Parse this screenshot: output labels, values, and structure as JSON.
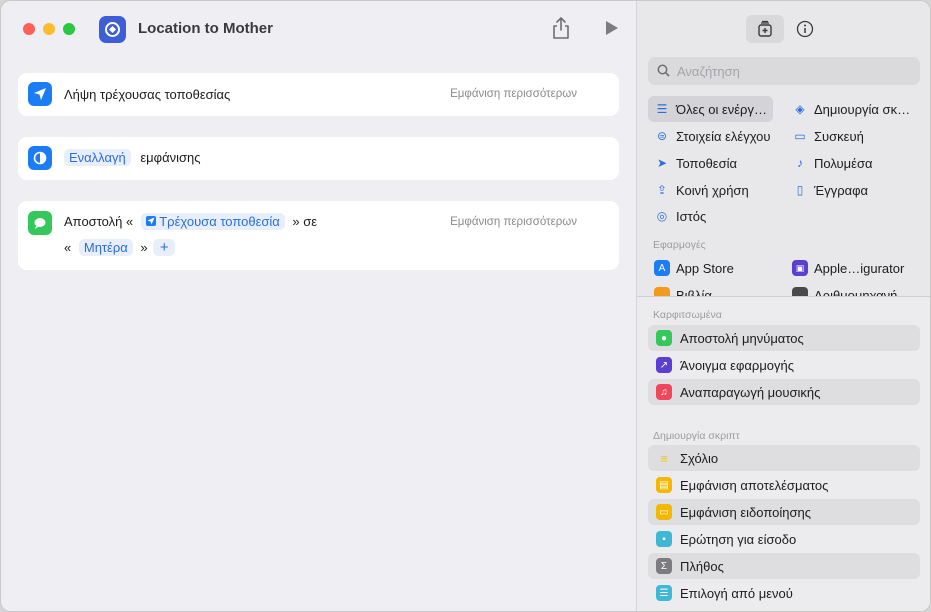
{
  "window": {
    "title": "Location to Mother"
  },
  "actions": [
    {
      "text": "Λήψη τρέχουσας τοποθεσίας",
      "more": "Εμφάνιση περισσότερων"
    },
    {
      "token": "Εναλλαγή",
      "text": "εμφάνισης"
    },
    {
      "prefix": "Αποστολή «",
      "token": "Τρέχουσα τοποθεσία",
      "mid": "» σε",
      "open": "«",
      "token2": "Μητέρα",
      "close": "»",
      "more": "Εμφάνιση περισσότερων"
    }
  ],
  "library": {
    "search_placeholder": "Αναζήτηση",
    "categories": [
      "Όλες οι ενέργ…",
      "Δημιουργία σκ…",
      "Στοιχεία ελέγχου",
      "Συσκευή",
      "Τοποθεσία",
      "Πολυμέσα",
      "Κοινή χρήση",
      "Έγγραφα",
      "Ιστός"
    ],
    "apps_header": "Εφαρμογές",
    "apps": [
      "App Store",
      "Apple…igurator",
      "Βιβλία",
      "Αριθμομηχανή"
    ],
    "pinned_header": "Καρφιτσωμένα",
    "pinned": [
      "Αποστολή μηνύματος",
      "Άνοιγμα εφαρμογής",
      "Αναπαραγωγή μουσικής"
    ],
    "scripting_header": "Δημιουργία σκριπτ",
    "scripting": [
      "Σχόλιο",
      "Εμφάνιση αποτελέσματος",
      "Εμφάνιση ειδοποίησης",
      "Ερώτηση για είσοδο",
      "Πλήθος",
      "Επιλογή από μενού"
    ]
  },
  "colors": {
    "accent": "#2a6ee0",
    "location": "#1b7cf5",
    "messages": "#34c759"
  }
}
